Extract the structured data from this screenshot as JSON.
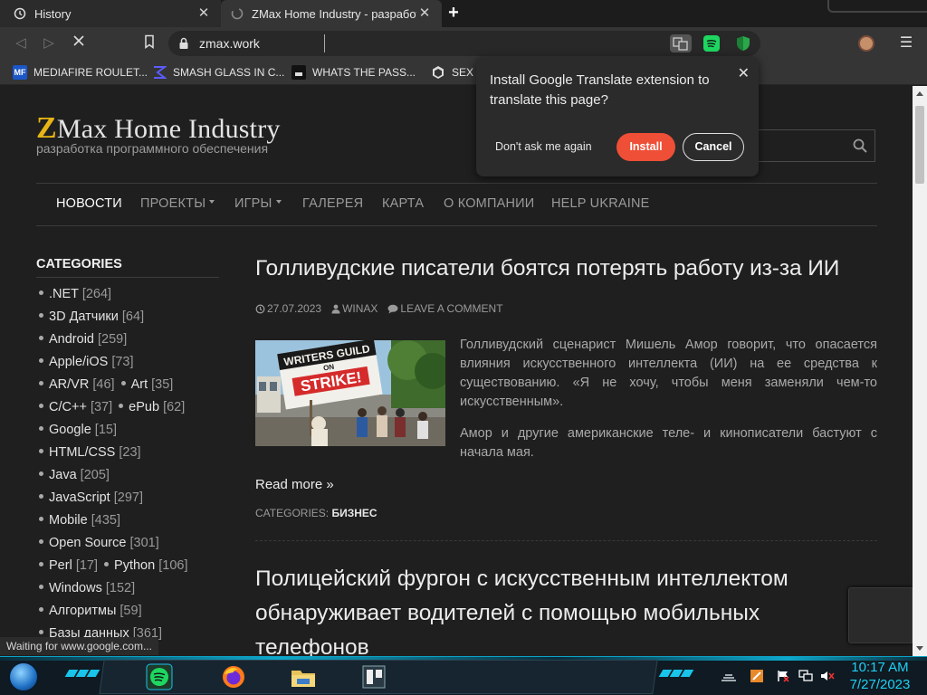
{
  "browser": {
    "tabs": [
      {
        "title": "History",
        "icon": "history-icon"
      },
      {
        "title": "ZMax Home Industry - разработка программного обеспечения",
        "icon": "page-favicon"
      }
    ],
    "url": "zmax.work",
    "bookmarks": [
      {
        "label": "MEDIAFIRE ROULET...",
        "icon": "mediafire-icon"
      },
      {
        "label": "SMASH GLASS IN C...",
        "icon": "smash-icon"
      },
      {
        "label": "WHATS THE PASS...",
        "icon": "bookmark-dark-icon"
      },
      {
        "label": "SEX I",
        "icon": "bookmark-star-icon"
      }
    ],
    "status_text": "Waiting for www.google.com..."
  },
  "translate_popup": {
    "message": "Install Google Translate extension to translate this page?",
    "dont_ask": "Don't ask me again",
    "install": "Install",
    "cancel": "Cancel"
  },
  "site": {
    "title_z": "Z",
    "title_rest": "Max Home Industry",
    "subtitle": "разработка программного обеспечения",
    "nav": [
      "НОВОСТИ",
      "ПРОЕКТЫ",
      "ИГРЫ",
      "ГАЛЕРЕЯ",
      "КАРТА",
      "О КОМПАНИИ",
      "HELP UKRAINE"
    ]
  },
  "sidebar": {
    "heading": "CATEGORIES",
    "rows": [
      [
        {
          "name": ".NET",
          "count": "[264]"
        }
      ],
      [
        {
          "name": "3D Датчики",
          "count": "[64]"
        }
      ],
      [
        {
          "name": "Android",
          "count": "[259]"
        }
      ],
      [
        {
          "name": "Apple/iOS",
          "count": "[73]"
        }
      ],
      [
        {
          "name": "AR/VR",
          "count": "[46]"
        },
        {
          "name": "Art",
          "count": "[35]"
        }
      ],
      [
        {
          "name": "C/C++",
          "count": "[37]"
        },
        {
          "name": "ePub",
          "count": "[62]"
        }
      ],
      [
        {
          "name": "Google",
          "count": "[15]"
        }
      ],
      [
        {
          "name": "HTML/CSS",
          "count": "[23]"
        }
      ],
      [
        {
          "name": "Java",
          "count": "[205]"
        }
      ],
      [
        {
          "name": "JavaScript",
          "count": "[297]"
        }
      ],
      [
        {
          "name": "Mobile",
          "count": "[435]"
        }
      ],
      [
        {
          "name": "Open Source",
          "count": "[301]"
        }
      ],
      [
        {
          "name": "Perl",
          "count": "[17]"
        },
        {
          "name": "Python",
          "count": "[106]"
        }
      ],
      [
        {
          "name": "Windows",
          "count": "[152]"
        }
      ],
      [
        {
          "name": "Алгоритмы",
          "count": "[59]"
        }
      ],
      [
        {
          "name": "Базы данных",
          "count": "[361]"
        }
      ]
    ]
  },
  "post1": {
    "title": "Голливудские писатели боятся потерять работу из-за ИИ",
    "date": "27.07.2023",
    "author": "WINAX",
    "comment": "LEAVE A COMMENT",
    "paragraphs": [
      "Голливудский сценарист Мишель Амор говорит, что опасается влияния искусственного интеллекта (ИИ) на ее средства к существованию. «Я не хочу, чтобы меня заменяли чем-то искусственным».",
      "Амор и другие американские теле- и кинописатели бастуют с начала мая."
    ],
    "sign_text": [
      "WRITERS GUILD",
      "ON",
      "STRIKE!"
    ],
    "read_more": "Read more »",
    "categories_label": "CATEGORIES:",
    "category": "БИЗНЕС"
  },
  "post2": {
    "title": "Полицейский фургон с искусственным интеллектом обнаруживает водителей с помощью мобильных телефонов"
  },
  "taskbar": {
    "time": "10:17 AM",
    "date": "7/27/2023"
  },
  "colors": {
    "accent_orange": "#ef4f36",
    "logo_yellow": "#e7b416",
    "taskbar_cyan": "#1ed0f5"
  }
}
